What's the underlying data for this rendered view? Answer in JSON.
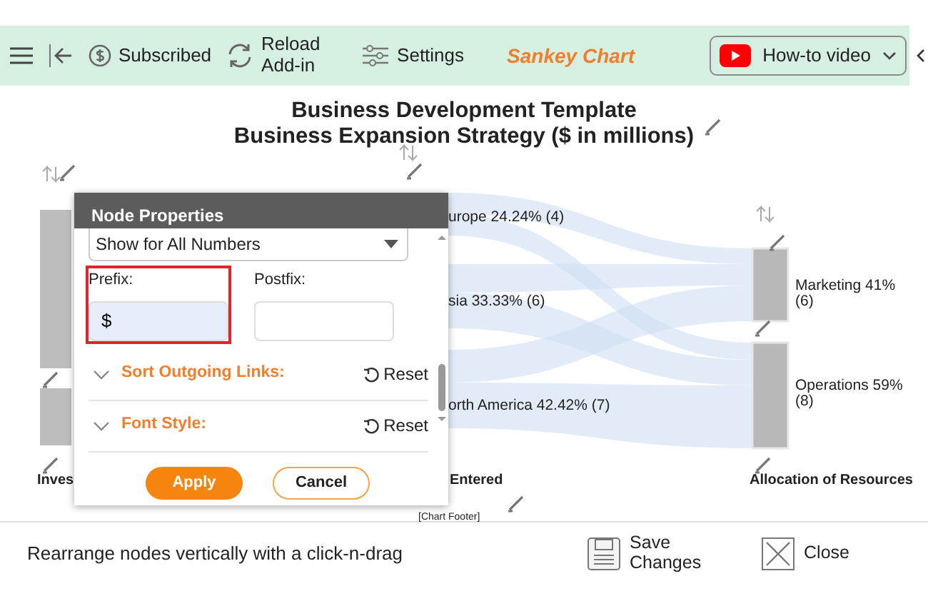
{
  "toolbar": {
    "buttons": [
      {
        "kind": "menu"
      },
      {
        "kind": "back"
      },
      {
        "kind": "subscribed",
        "label": "Subscribed"
      },
      {
        "kind": "reload",
        "label": "Reload Add-in"
      },
      {
        "kind": "settings",
        "label": "Settings"
      }
    ],
    "brand": "Sankey Chart",
    "video_button": "How-to video"
  },
  "chart": {
    "title": "Business Development Template",
    "subtitle": "Business Expansion Strategy ($ in millions)",
    "middle_nodes": [
      {
        "label": "urope 24.24% (4)"
      },
      {
        "label": "sia 33.33% (6)"
      },
      {
        "label": "orth America 42.42% (7)"
      }
    ],
    "right_nodes": [
      {
        "label": "Marketing 41% (6)"
      },
      {
        "label": "Operations 59% (8)"
      }
    ],
    "column_labels": [
      "Inves",
      "Entered",
      "Allocation of Resources"
    ],
    "footer": "[Chart Footer]"
  },
  "dialog": {
    "title": "Node Properties",
    "select_value": "Show for All Numbers",
    "fields": [
      {
        "label": "Prefix:",
        "value": "$",
        "highlighted": true
      },
      {
        "label": "Postfix:",
        "highlighted": false
      }
    ],
    "sections": [
      {
        "label": "Sort Outgoing Links:",
        "reset": "Reset",
        "expanded": false
      },
      {
        "label": "Font Style:",
        "reset": "Reset",
        "expanded": false
      }
    ],
    "buttons": [
      {
        "kind": "primary",
        "label": "Apply"
      },
      {
        "kind": "secondary",
        "label": "Cancel"
      }
    ]
  },
  "status_bar": {
    "hint": "Rearrange nodes vertically with a click-n-drag",
    "buttons": [
      {
        "kind": "save",
        "label": "Save Changes"
      },
      {
        "kind": "close",
        "label": "Close"
      }
    ]
  }
}
